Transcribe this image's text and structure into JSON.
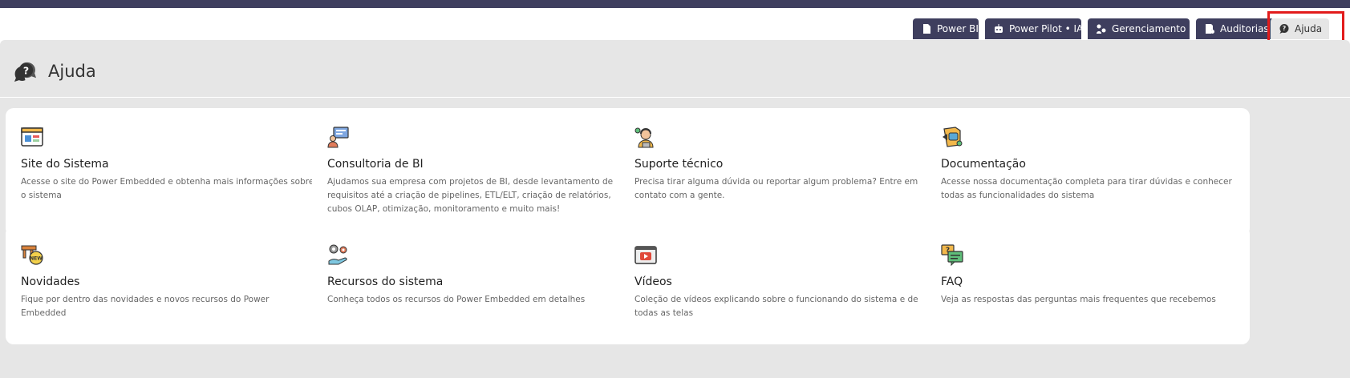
{
  "tabs": [
    {
      "label": "Power BI",
      "icon": "report-icon"
    },
    {
      "label": "Power Pilot • IA",
      "icon": "robot-icon"
    },
    {
      "label": "Gerenciamento",
      "icon": "settings-users-icon"
    },
    {
      "label": "Auditorias",
      "icon": "audit-icon"
    },
    {
      "label": "Ajuda",
      "icon": "help-chat-icon",
      "active": true
    }
  ],
  "page": {
    "title": "Ajuda",
    "icon": "help-chat-icon"
  },
  "cards": [
    {
      "title": "Site do Sistema",
      "description": "Acesse o site do Power Embedded e obtenha mais informações sobre o sistema",
      "icon": "website-icon"
    },
    {
      "title": "Consultoria de BI",
      "description": "Ajudamos sua empresa com projetos de BI, desde levantamento de requisitos até a criação de pipelines, ETL/ELT, criação de relatórios, cubos OLAP, otimização, monitoramento e muito mais!",
      "icon": "consulting-icon"
    },
    {
      "title": "Suporte técnico",
      "description": "Precisa tirar alguma dúvida ou reportar algum problema? Entre em contato com a gente.",
      "icon": "support-agent-icon"
    },
    {
      "title": "Documentação",
      "description": "Acesse nossa documentação completa para tirar dúvidas e conhecer todas as funcionalidades do sistema",
      "icon": "documentation-icon"
    },
    {
      "title": "Novidades",
      "description": "Fique por dentro das novidades e novos recursos do Power Embedded",
      "icon": "new-badge-icon"
    },
    {
      "title": "Recursos do sistema",
      "description": "Conheça todos os recursos do Power Embedded em detalhes",
      "icon": "features-gears-icon"
    },
    {
      "title": "Vídeos",
      "description": "Coleção de vídeos explicando sobre o funcionando do sistema e de todas as telas",
      "icon": "video-player-icon"
    },
    {
      "title": "FAQ",
      "description": "Veja as respostas das perguntas mais frequentes que recebemos",
      "icon": "faq-chat-icon"
    }
  ],
  "colors": {
    "nav": "#3e3e5e",
    "panel": "#e6e6e6",
    "highlight": "#e21b1b"
  }
}
